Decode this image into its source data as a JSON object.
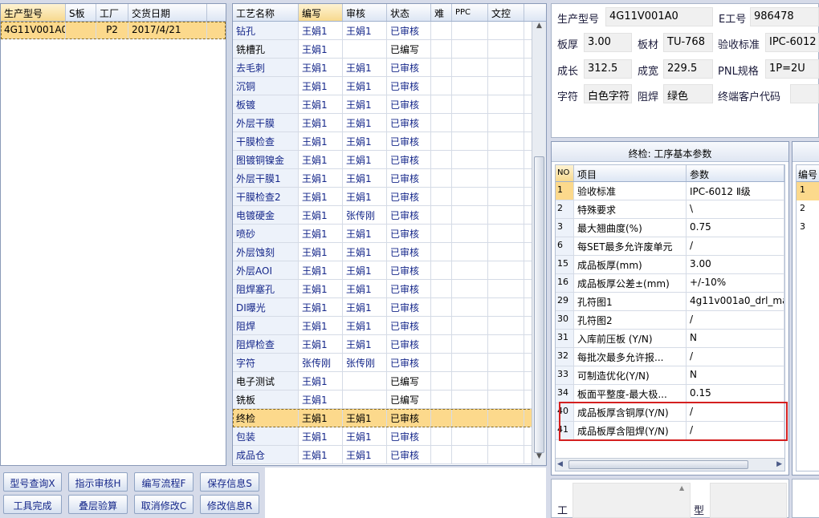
{
  "left_table": {
    "columns": [
      "生产型号",
      "S板",
      "工厂",
      "交货日期"
    ],
    "rows": [
      [
        "4G11V001A0",
        "",
        "P2",
        "2017/4/21"
      ]
    ]
  },
  "process_table": {
    "columns": [
      "工艺名称",
      "编写",
      "审核",
      "状态",
      "难",
      "PPC",
      "文控"
    ],
    "rows": [
      [
        "钻孔",
        "王娟1",
        "王娟1",
        "已审核"
      ],
      [
        "铣槽孔",
        "王娟1",
        "",
        "已编写"
      ],
      [
        "去毛刺",
        "王娟1",
        "王娟1",
        "已审核"
      ],
      [
        "沉铜",
        "王娟1",
        "王娟1",
        "已审核"
      ],
      [
        "板镀",
        "王娟1",
        "王娟1",
        "已审核"
      ],
      [
        "外层干膜",
        "王娟1",
        "王娟1",
        "已审核"
      ],
      [
        "干膜检查",
        "王娟1",
        "王娟1",
        "已审核"
      ],
      [
        "图镀铜镍金",
        "王娟1",
        "王娟1",
        "已审核"
      ],
      [
        "外层干膜1",
        "王娟1",
        "王娟1",
        "已审核"
      ],
      [
        "干膜检查2",
        "王娟1",
        "王娟1",
        "已审核"
      ],
      [
        "电镀硬金",
        "王娟1",
        "张传刚",
        "已审核"
      ],
      [
        "喷砂",
        "王娟1",
        "王娟1",
        "已审核"
      ],
      [
        "外层蚀刻",
        "王娟1",
        "王娟1",
        "已审核"
      ],
      [
        "外层AOI",
        "王娟1",
        "王娟1",
        "已审核"
      ],
      [
        "阻焊塞孔",
        "王娟1",
        "王娟1",
        "已审核"
      ],
      [
        "DI曝光",
        "王娟1",
        "王娟1",
        "已审核"
      ],
      [
        "阻焊",
        "王娟1",
        "王娟1",
        "已审核"
      ],
      [
        "阻焊检查",
        "王娟1",
        "王娟1",
        "已审核"
      ],
      [
        "字符",
        "张传刚",
        "张传刚",
        "已审核"
      ],
      [
        "电子测试",
        "王娟1",
        "",
        "已编写"
      ],
      [
        "铣板",
        "王娟1",
        "",
        "已编写"
      ],
      [
        "终检",
        "王娟1",
        "王娟1",
        "已审核"
      ],
      [
        "包装",
        "王娟1",
        "王娟1",
        "已审核"
      ],
      [
        "成品仓",
        "王娟1",
        "王娟1",
        "已审核"
      ]
    ],
    "selected_index": 21
  },
  "buttons": {
    "row1": [
      "型号查询X",
      "指示审核H",
      "编写流程F",
      "保存信息S"
    ],
    "row2": [
      "工具完成",
      "叠层验算",
      "取消修改C",
      "修改信息R"
    ]
  },
  "info": {
    "model_label": "生产型号",
    "model_value": "4G11V001A0",
    "e_label": "E工号",
    "e_value": "986478",
    "thick_label": "板厚",
    "thick_value": "3.00",
    "material_label": "板材",
    "material_value": "TU-768",
    "std_label": "验收标准",
    "std_value": "IPC-6012",
    "len_label": "成长",
    "len_value": "312.5",
    "width_label": "成宽",
    "width_value": "229.5",
    "pnl_label": "PNL规格",
    "pnl_value": "1P=2U",
    "char_label": "字符",
    "char_value": "白色字符",
    "mask_label": "阻焊",
    "mask_value": "绿色",
    "customer_label": "终端客户代码",
    "customer_value": ""
  },
  "params_panel": {
    "title": "终检: 工序基本参数",
    "columns": [
      "NO",
      "项目",
      "参数"
    ],
    "rows": [
      [
        "1",
        "验收标准",
        "IPC-6012 Ⅱ级"
      ],
      [
        "2",
        "特殊要求",
        "\\"
      ],
      [
        "3",
        "最大翘曲度(%)",
        "0.75"
      ],
      [
        "6",
        "每SET最多允许废单元",
        "/"
      ],
      [
        "15",
        "成品板厚(mm)",
        "3.00"
      ],
      [
        "16",
        "成品板厚公差±(mm)",
        "+/-10%"
      ],
      [
        "29",
        "孔符图1",
        "4g11v001a0_drl_ma"
      ],
      [
        "30",
        "孔符图2",
        "/"
      ],
      [
        "31",
        "入库前压板 (Y/N)",
        "N"
      ],
      [
        "32",
        "每批次最多允许报...",
        "/"
      ],
      [
        "33",
        "可制造优化(Y/N)",
        "N"
      ],
      [
        "34",
        "板面平整度-最大极...",
        "0.15"
      ],
      [
        "40",
        "成品板厚含铜厚(Y/N)",
        "/"
      ],
      [
        "41",
        "成品板厚含阻焊(Y/N)",
        "/"
      ]
    ]
  },
  "right_table": {
    "column": "编号",
    "rows": [
      "1",
      "2",
      "3"
    ]
  },
  "bottom_labels": {
    "left": "工",
    "right": "型"
  },
  "colors": {
    "selected_row": "#fcd98c",
    "highlight_border": "#d42020",
    "text_blue": "#15278a"
  }
}
